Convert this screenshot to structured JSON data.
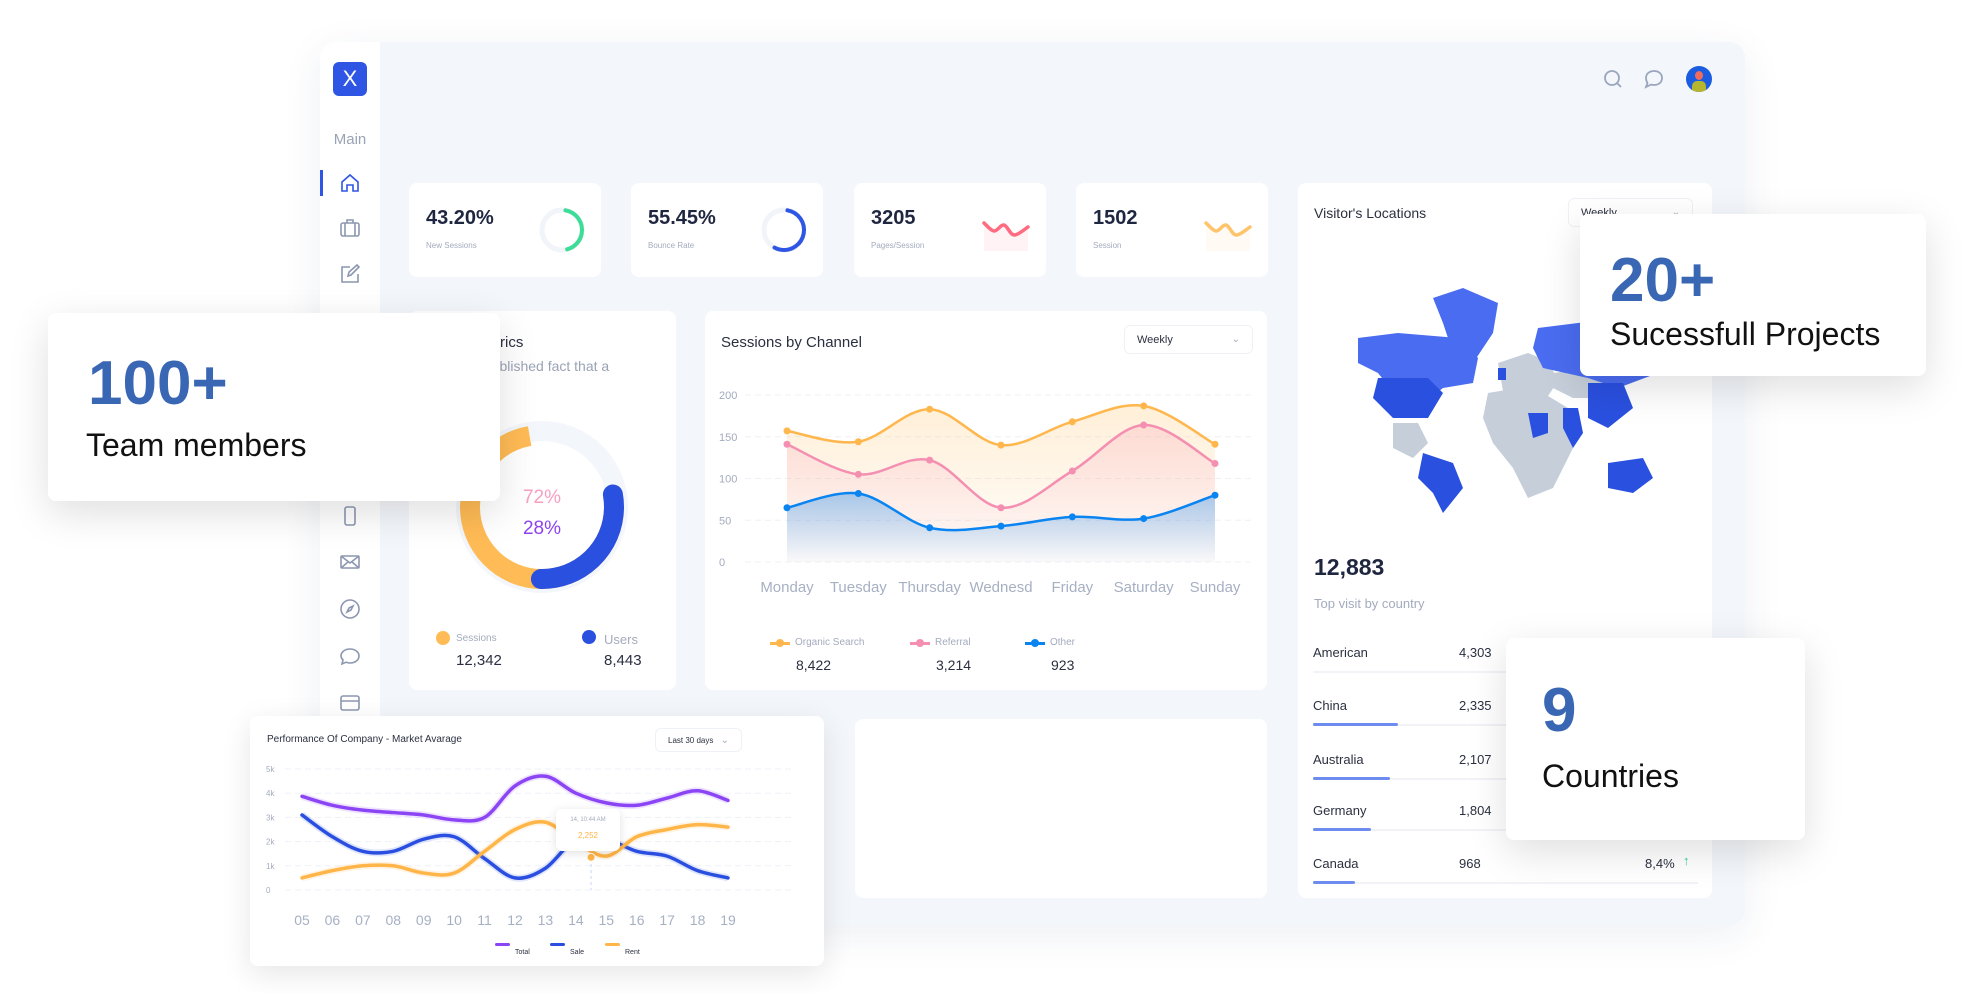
{
  "sidebar": {
    "logo": "X",
    "section": "Main",
    "items": [
      "home",
      "briefcase",
      "edit",
      "mobile",
      "mail",
      "compass",
      "chat",
      "credit-card"
    ],
    "active": "home"
  },
  "header": {
    "icons": [
      "search-icon",
      "chat-icon",
      "avatar"
    ]
  },
  "stats": [
    {
      "value": "43.20%",
      "label": "New Sessions",
      "chart": "ring",
      "color": "#3ddc97",
      "fraction": 0.43
    },
    {
      "value": "55.45%",
      "label": "Bounce Rate",
      "chart": "ring",
      "color": "#2f55e4",
      "fraction": 0.55
    },
    {
      "value": "3205",
      "label": "Pages/Session",
      "chart": "sparkline",
      "color": "#ff6b81"
    },
    {
      "value": "1502",
      "label": "Session",
      "chart": "sparkline",
      "color": "#ffc46b"
    }
  ],
  "metrics": {
    "title": "Metrics",
    "subtitle": "established fact that a",
    "donut": {
      "outer_pct": "72%",
      "inner_pct": "28%",
      "segments": [
        {
          "name": "Sessions",
          "value": 72,
          "color": "#ffbb55"
        },
        {
          "name": "Users",
          "value": 28,
          "color": "#2a50e0"
        }
      ]
    },
    "legend": [
      {
        "label": "Sessions",
        "value": "12,342",
        "color": "#ffbb55"
      },
      {
        "label": "Users",
        "value": "8,443",
        "color": "#2a50e0"
      }
    ]
  },
  "sessions": {
    "title": "Sessions by Channel",
    "dropdown": "Weekly",
    "legend": [
      {
        "label": "Organic Search",
        "value": "8,422",
        "color": "#ffb74d"
      },
      {
        "label": "Referral",
        "value": "3,214",
        "color": "#f48fb1"
      },
      {
        "label": "Other",
        "value": "923",
        "color": "#0a84f0"
      }
    ]
  },
  "visitors": {
    "title": "Visitor's Locations",
    "dropdown": "Weekly",
    "total": "12,883",
    "total_label": "Top visit by country",
    "countries": [
      {
        "name": "American",
        "count": "4,303",
        "bar": 0
      },
      {
        "name": "China",
        "count": "2,335",
        "bar": 0.22
      },
      {
        "name": "Australia",
        "count": "2,107",
        "bar": 0.2
      },
      {
        "name": "Germany",
        "count": "1,804",
        "bar": 0.15
      },
      {
        "name": "Canada",
        "count": "968",
        "bar": 0.11,
        "change": "8,4%",
        "trend": "up"
      }
    ],
    "map_color": "#2f55e4",
    "map_muted": "#c5ced9"
  },
  "performance": {
    "title": "Performance Of Company - Market Avarage",
    "dropdown": "Last 30 days",
    "tooltip": {
      "time": "14, 10:44 AM",
      "value": "2,252"
    }
  },
  "overlays": [
    {
      "number": "100+",
      "label": "Team members"
    },
    {
      "number": "20+",
      "label": "Sucessfull Projects"
    },
    {
      "number": "9",
      "label": "Countries"
    }
  ],
  "chart_data": [
    {
      "type": "area",
      "title": "Sessions by Channel",
      "categories": [
        "Monday",
        "Tuesday",
        "Thursday",
        "Wednesd",
        "Friday",
        "Saturday",
        "Sunday"
      ],
      "ylim": [
        0,
        200
      ],
      "yticks": [
        0,
        50,
        100,
        150,
        200
      ],
      "grid": true,
      "legend": "bottom",
      "series": [
        {
          "name": "Organic Search",
          "color": "#ffb74d",
          "values": [
            157,
            144,
            183,
            140,
            168,
            187,
            141
          ]
        },
        {
          "name": "Referral",
          "color": "#f48fb1",
          "values": [
            141,
            105,
            122,
            65,
            109,
            164,
            118
          ]
        },
        {
          "name": "Other",
          "color": "#0a84f0",
          "values": [
            65,
            82,
            41,
            43,
            54,
            52,
            80
          ]
        }
      ]
    },
    {
      "type": "line",
      "title": "Performance Of Company - Market Avarage",
      "categories": [
        "05",
        "06",
        "07",
        "08",
        "09",
        "10",
        "11",
        "12",
        "13",
        "14",
        "15",
        "16",
        "17",
        "18",
        "19"
      ],
      "ylim": [
        0,
        5000
      ],
      "yticks": [
        "0",
        "1k",
        "2k",
        "3k",
        "4k",
        "5k"
      ],
      "grid": true,
      "legend": "bottom-right",
      "series": [
        {
          "name": "Total",
          "color": "#8b45f5",
          "values": [
            3870,
            3500,
            3300,
            3200,
            3100,
            2900,
            3000,
            4300,
            4700,
            4000,
            3600,
            3500,
            3800,
            4100,
            3700
          ]
        },
        {
          "name": "Sale",
          "color": "#2a4fe0",
          "values": [
            3100,
            2200,
            1600,
            1600,
            2100,
            2200,
            1300,
            500,
            900,
            2100,
            2100,
            1600,
            1400,
            800,
            500
          ]
        },
        {
          "name": "Rent",
          "color": "#ffb547",
          "values": [
            500,
            800,
            1000,
            1000,
            700,
            700,
            1600,
            2500,
            2800,
            2000,
            1400,
            2200,
            2500,
            2700,
            2600
          ]
        }
      ]
    }
  ]
}
